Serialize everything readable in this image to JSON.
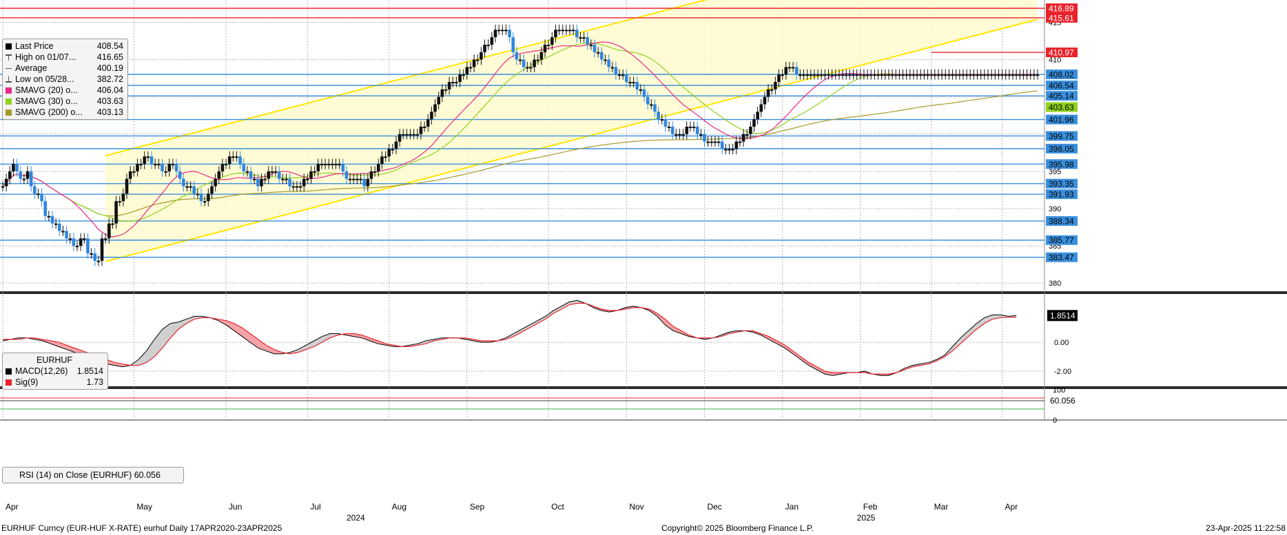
{
  "colors": {
    "grid": "#b5b5b5",
    "up": "#111111",
    "down": "#2f86e0",
    "blue_level": "#3a8fdc",
    "red_level": "#e8232b",
    "channel": "#ffe600",
    "channel_fill": "#fffbd0",
    "sma20": "#e8298d",
    "sma30": "#8fd21f",
    "sma200": "#a69a2a",
    "macd_fill_up": "#cfcfcf",
    "macd_fill_down": "#f5a3a8",
    "macd_line": "#000000",
    "signal_line": "#e8232b"
  },
  "legend_price": {
    "rows": [
      {
        "icon": "square-black-icon",
        "label": "Last Price",
        "value": "408.54",
        "color": "#000000"
      },
      {
        "icon": "high-marker-icon",
        "label": "High on 01/07...",
        "value": "416.65",
        "color": "#555555"
      },
      {
        "icon": "average-line-icon",
        "label": "Average",
        "value": "400.19",
        "color": "#555555"
      },
      {
        "icon": "low-marker-icon",
        "label": "Low on 05/28...",
        "value": "382.72",
        "color": "#555555"
      },
      {
        "icon": "square-magenta-icon",
        "label": "SMAVG (20)  o...",
        "value": "406.04",
        "color": "#e8298d"
      },
      {
        "icon": "square-green-icon",
        "label": "SMAVG (30)  o...",
        "value": "403.63",
        "color": "#8fd21f"
      },
      {
        "icon": "square-olive-icon",
        "label": "SMAVG (200)  o...",
        "value": "403.13",
        "color": "#a69a2a"
      }
    ]
  },
  "legend_macd": {
    "title": "EURHUF",
    "rows": [
      {
        "icon": "square-black-icon",
        "label": "MACD(12,26)",
        "value": "1.8514",
        "color": "#000000"
      },
      {
        "icon": "square-red-icon",
        "label": "Sig(9)",
        "value": "1.73",
        "color": "#e8232b"
      }
    ]
  },
  "legend_rsi": {
    "text": "RSI (14)  on Close (EURHUF)  60.056"
  },
  "footer": {
    "left": "EURHUF Curncy (EUR-HUF X-RATE) eurhuf  Daily 17APR2020-23APR2025",
    "center": "Copyright© 2025 Bloomberg Finance L.P.",
    "right": "23-Apr-2025 11:22:58"
  },
  "chart_data": [
    {
      "type": "candlestick",
      "title": "EURHUF Curncy (EUR-HUF X-RATE)",
      "ylim": [
        379,
        418
      ],
      "y_ticks": [
        380,
        385,
        390,
        395,
        400,
        405,
        410,
        415
      ],
      "x_months": [
        "Apr",
        "May",
        "Jun",
        "Jul",
        "Aug",
        "Sep",
        "Oct",
        "Nov",
        "Dec",
        "Jan",
        "Feb",
        "Mar",
        "Apr"
      ],
      "x_month_index": [
        0,
        37,
        63,
        86,
        109,
        131,
        154,
        176,
        198,
        220,
        242,
        262,
        282
      ],
      "year_labels": [
        {
          "label": "2024",
          "index": 97
        },
        {
          "label": "2025",
          "index": 241
        }
      ],
      "close": [
        393,
        394,
        395,
        396,
        395,
        394,
        394,
        395,
        393,
        392,
        392,
        391,
        389,
        389,
        388,
        388,
        387,
        387,
        386,
        386,
        385,
        385,
        386,
        386,
        384,
        384,
        383,
        383,
        386,
        386,
        388,
        388,
        391,
        391,
        392,
        394,
        395,
        395,
        396,
        396,
        397,
        397,
        396,
        396,
        396,
        395,
        395,
        396,
        396,
        395,
        394,
        393,
        393,
        393,
        392,
        392,
        391,
        391,
        392,
        393,
        394,
        395,
        396,
        396,
        397,
        397,
        397,
        396,
        395,
        395,
        394,
        394,
        393,
        394,
        394,
        395,
        395,
        395,
        394,
        394,
        394,
        393,
        393,
        393,
        393,
        394,
        394,
        395,
        395,
        396,
        396,
        396,
        396,
        396,
        396,
        396,
        395,
        394,
        394,
        394,
        394,
        394,
        393,
        394,
        395,
        395,
        396,
        397,
        397,
        398,
        398,
        399,
        400,
        400,
        400,
        400,
        400,
        400,
        401,
        401,
        402,
        403,
        404,
        405,
        406,
        406,
        407,
        407,
        407,
        408,
        408,
        409,
        409,
        410,
        410,
        411,
        412,
        412,
        413,
        414,
        414,
        414,
        414,
        413,
        411,
        410,
        410,
        409,
        409,
        409,
        410,
        410,
        411,
        412,
        412,
        413,
        414,
        414,
        414,
        414,
        414,
        414,
        413,
        413,
        413,
        412,
        412,
        411,
        411,
        410,
        410,
        409,
        409,
        408,
        408,
        408,
        407,
        407,
        407,
        406,
        406,
        405,
        404,
        404,
        403,
        402,
        402,
        401,
        401,
        400,
        400,
        400,
        400,
        401,
        401,
        401,
        400,
        400,
        399,
        399,
        399,
        399,
        399,
        398,
        398,
        398,
        398,
        399,
        399,
        400,
        400,
        401,
        402,
        403,
        404,
        405,
        406,
        406,
        407,
        408,
        408,
        409,
        409,
        409,
        408,
        408,
        408,
        408,
        408,
        408,
        408,
        408,
        408,
        408,
        408,
        408,
        408,
        408,
        408,
        408,
        408,
        408,
        408,
        408,
        408,
        408,
        408,
        408,
        408,
        408,
        408,
        408,
        408,
        408,
        408,
        408,
        408,
        408,
        408,
        408,
        408,
        408,
        408,
        408,
        408,
        408,
        408,
        408,
        408,
        408,
        408,
        408,
        408,
        408,
        408,
        408,
        408,
        408,
        408,
        408,
        408,
        408,
        408,
        408,
        408,
        408,
        408,
        408,
        408,
        408,
        408,
        408,
        408
      ],
      "ohlc_note": "Daily candles, 17APR2020-23APR2025 view (Apr 2024 - Apr 2025 shown)",
      "horizontal_levels": [
        416.89,
        415.61,
        410.97,
        408.02,
        406.54,
        405.14,
        401.96,
        399.75,
        398.05,
        395.98,
        393.35,
        391.93,
        388.34,
        385.77,
        383.47
      ],
      "level_colors": {
        "416.89": "red",
        "415.61": "red",
        "410.97": "red"
      },
      "axis_tags": [
        {
          "label": "416.89",
          "value": 416.89,
          "color": "#e8232b"
        },
        {
          "label": "415.61",
          "value": 415.61,
          "color": "#e8232b"
        },
        {
          "label": "410.97",
          "value": 410.97,
          "color": "#e8232b"
        },
        {
          "label": "408.02",
          "value": 408.02,
          "color": "#3a8fdc"
        },
        {
          "label": "406.54",
          "value": 406.54,
          "color": "#3a8fdc"
        },
        {
          "label": "405.14",
          "value": 405.14,
          "color": "#3a8fdc"
        },
        {
          "label": "403.63",
          "value": 403.63,
          "color": "#8fd21f"
        },
        {
          "label": "401.96",
          "value": 401.96,
          "color": "#3a8fdc"
        },
        {
          "label": "399.75",
          "value": 399.75,
          "color": "#3a8fdc"
        },
        {
          "label": "398.05",
          "value": 398.05,
          "color": "#3a8fdc"
        },
        {
          "label": "395.98",
          "value": 395.98,
          "color": "#3a8fdc"
        },
        {
          "label": "393.35",
          "value": 393.35,
          "color": "#3a8fdc"
        },
        {
          "label": "391.93",
          "value": 391.93,
          "color": "#3a8fdc"
        },
        {
          "label": "388.34",
          "value": 388.34,
          "color": "#3a8fdc"
        },
        {
          "label": "385.77",
          "value": 385.77,
          "color": "#3a8fdc"
        },
        {
          "label": "383.47",
          "value": 383.47,
          "color": "#3a8fdc"
        }
      ],
      "series": [
        {
          "name": "SMAVG (20)",
          "last": 406.04
        },
        {
          "name": "SMAVG (30)",
          "last": 403.63
        },
        {
          "name": "SMAVG (200)",
          "last": 403.13
        }
      ],
      "channel": {
        "lower_start": [
          29,
          382.9
        ],
        "lower_end": [
          292,
          415.4
        ],
        "upper_start": [
          29,
          397.1
        ],
        "upper_end": [
          292,
          429.6
        ]
      }
    },
    {
      "type": "line",
      "title": "EURHUF",
      "ylim": [
        -3,
        3.2
      ],
      "y_ticks": [
        -2.0,
        0.0
      ],
      "y_tick_labels": [
        "-2.00",
        "0.00"
      ],
      "last_tag": "1.8514",
      "series": [
        {
          "name": "MACD(12,26)",
          "last": 1.8514,
          "values": [
            0.1,
            0.2,
            0.3,
            0.3,
            0.2,
            0.1,
            -0.1,
            -0.3,
            -0.5,
            -0.7,
            -0.9,
            -1.1,
            -1.3,
            -1.5,
            -1.6,
            -1.7,
            -1.6,
            -1.2,
            -0.6,
            0.2,
            0.9,
            1.3,
            1.4,
            1.6,
            1.8,
            1.8,
            1.7,
            1.5,
            1.2,
            0.8,
            0.4,
            0.0,
            -0.4,
            -0.6,
            -0.8,
            -0.8,
            -0.7,
            -0.5,
            -0.2,
            0.1,
            0.4,
            0.6,
            0.6,
            0.5,
            0.4,
            0.3,
            0.1,
            -0.1,
            -0.2,
            -0.3,
            -0.3,
            -0.2,
            -0.1,
            0.1,
            0.2,
            0.3,
            0.3,
            0.3,
            0.2,
            0.1,
            0.0,
            0.0,
            0.1,
            0.3,
            0.6,
            0.9,
            1.2,
            1.5,
            1.8,
            2.2,
            2.5,
            2.8,
            2.9,
            2.7,
            2.4,
            2.2,
            2.1,
            2.2,
            2.4,
            2.5,
            2.4,
            2.2,
            1.8,
            1.2,
            0.8,
            0.6,
            0.4,
            0.3,
            0.2,
            0.3,
            0.5,
            0.7,
            0.8,
            0.8,
            0.7,
            0.5,
            0.2,
            -0.1,
            -0.4,
            -0.8,
            -1.2,
            -1.6,
            -1.9,
            -2.2,
            -2.3,
            -2.2,
            -2.1,
            -2.1,
            -2.0,
            -2.2,
            -2.3,
            -2.3,
            -2.1,
            -1.8,
            -1.6,
            -1.5,
            -1.4,
            -1.2,
            -0.9,
            -0.3,
            0.3,
            0.8,
            1.3,
            1.7,
            1.9,
            1.9,
            1.8,
            1.85
          ]
        },
        {
          "name": "Sig(9)",
          "last": 1.73,
          "values": [
            0.2,
            0.2,
            0.2,
            0.3,
            0.3,
            0.2,
            0.1,
            0.0,
            -0.2,
            -0.4,
            -0.6,
            -0.8,
            -1.0,
            -1.2,
            -1.4,
            -1.5,
            -1.6,
            -1.6,
            -1.4,
            -1.0,
            -0.4,
            0.3,
            0.9,
            1.3,
            1.6,
            1.7,
            1.7,
            1.6,
            1.5,
            1.3,
            1.0,
            0.6,
            0.2,
            -0.2,
            -0.5,
            -0.7,
            -0.8,
            -0.7,
            -0.5,
            -0.3,
            0.0,
            0.3,
            0.5,
            0.6,
            0.6,
            0.5,
            0.3,
            0.1,
            -0.1,
            -0.2,
            -0.3,
            -0.3,
            -0.2,
            -0.1,
            0.1,
            0.2,
            0.3,
            0.3,
            0.3,
            0.2,
            0.1,
            0.1,
            0.1,
            0.2,
            0.4,
            0.7,
            1.0,
            1.3,
            1.6,
            2.0,
            2.3,
            2.6,
            2.7,
            2.7,
            2.5,
            2.3,
            2.2,
            2.2,
            2.3,
            2.4,
            2.4,
            2.3,
            2.0,
            1.6,
            1.1,
            0.8,
            0.5,
            0.3,
            0.3,
            0.3,
            0.4,
            0.6,
            0.7,
            0.8,
            0.8,
            0.6,
            0.4,
            0.1,
            -0.2,
            -0.6,
            -1.0,
            -1.4,
            -1.7,
            -2.0,
            -2.1,
            -2.1,
            -2.1,
            -2.1,
            -2.1,
            -2.2,
            -2.2,
            -2.2,
            -2.1,
            -1.9,
            -1.7,
            -1.6,
            -1.5,
            -1.3,
            -1.0,
            -0.6,
            -0.1,
            0.4,
            0.9,
            1.3,
            1.6,
            1.7,
            1.73,
            1.73
          ]
        }
      ]
    },
    {
      "type": "line",
      "title": "RSI (14)  on Close (EURHUF)",
      "ylim": [
        0,
        100
      ],
      "y_ticks": [
        0,
        100
      ],
      "y_tick_labels": [
        "0",
        "100"
      ],
      "last_tag": "60.056",
      "reference_levels": [
        70,
        30
      ],
      "series": [
        {
          "name": "RSI (14)",
          "last": 60.056
        }
      ]
    }
  ]
}
